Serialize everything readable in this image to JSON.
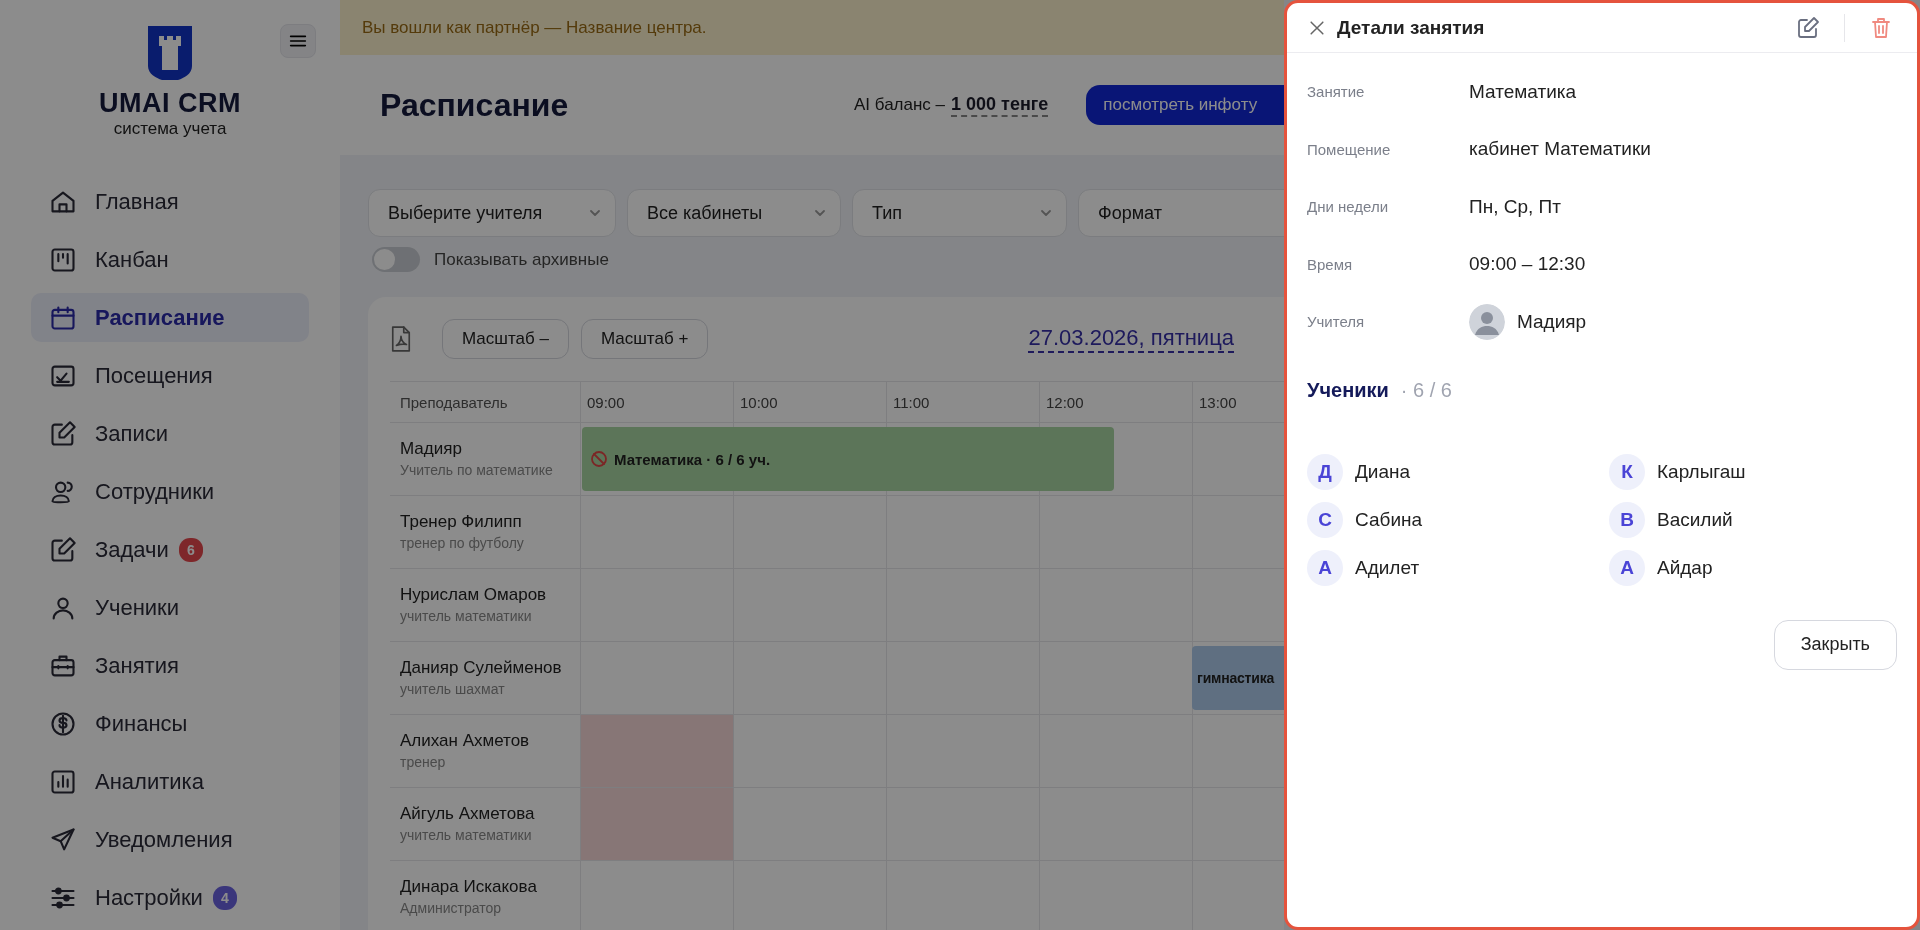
{
  "sidebar": {
    "logo": {
      "title": "UMAI CRM",
      "subtitle": "система учета"
    },
    "items": [
      {
        "label": "Главная",
        "selected": false
      },
      {
        "label": "Канбан",
        "selected": false
      },
      {
        "label": "Расписание",
        "selected": true
      },
      {
        "label": "Посещения",
        "selected": false
      },
      {
        "label": "Записи",
        "selected": false
      },
      {
        "label": "Сотрудники",
        "selected": false
      },
      {
        "label": "Задачи",
        "selected": false,
        "badge": {
          "text": "6",
          "kind": "alert"
        }
      },
      {
        "label": "Ученики",
        "selected": false
      },
      {
        "label": "Занятия",
        "selected": false
      },
      {
        "label": "Финансы",
        "selected": false
      },
      {
        "label": "Аналитика",
        "selected": false
      },
      {
        "label": "Уведомления",
        "selected": false
      },
      {
        "label": "Настройки",
        "selected": false,
        "badge": {
          "text": "4",
          "kind": "info"
        }
      }
    ]
  },
  "banner": "Вы вошли как партнёр — Название центра.",
  "header": {
    "title": "Расписание",
    "balance_label": "AI баланс –",
    "balance_value": "1 000 тенге",
    "button": "посмотреть инфоту"
  },
  "filters": [
    {
      "value": "Выберите учителя"
    },
    {
      "value": "Все кабинеты"
    },
    {
      "value": "Тип"
    },
    {
      "value": "Формат"
    }
  ],
  "archive_toggle": {
    "label": "Показывать архивные",
    "on": false
  },
  "toolbar": {
    "zoom_out": "Масштаб –",
    "zoom_in": "Масштаб +",
    "date": "27.03.2026, пятница"
  },
  "schedule": {
    "teacher_column": "Преподаватель",
    "hours": [
      "09:00",
      "10:00",
      "11:00",
      "12:00",
      "13:00"
    ],
    "rows": [
      {
        "name": "Мадияр",
        "role": "Учитель по математике",
        "cells": [
          {
            "kind": "free",
            "event": {
              "kind": "green",
              "title": "Математика · 6 / 6 уч.",
              "cancelled": true
            }
          },
          {
            "kind": "free"
          },
          {
            "kind": "free"
          },
          {
            "kind": "free"
          },
          {
            "kind": "free"
          }
        ]
      },
      {
        "name": "Тренер Филипп",
        "role": "тренер по футболу",
        "cells": [
          {
            "kind": "free"
          },
          {
            "kind": "free"
          },
          {
            "kind": "free"
          },
          {
            "kind": "free"
          },
          {
            "kind": "free"
          }
        ]
      },
      {
        "name": "Нурислам Омаров",
        "role": "учитель математики",
        "cells": [
          {
            "kind": "free"
          },
          {
            "kind": "free"
          },
          {
            "kind": "free"
          },
          {
            "kind": "free"
          },
          {
            "kind": "free"
          }
        ]
      },
      {
        "name": "Данияр Сулейменов",
        "role": "учитель шахмат",
        "cells": [
          {
            "kind": "free"
          },
          {
            "kind": "free"
          },
          {
            "kind": "free"
          },
          {
            "kind": "free"
          },
          {
            "kind": "free",
            "event": {
              "kind": "blue",
              "title": "гимнастика",
              "cancelled": false
            }
          }
        ]
      },
      {
        "name": "Алихан Ахметов",
        "role": "тренер",
        "cells": [
          {
            "kind": "blocked"
          },
          {
            "kind": "free"
          },
          {
            "kind": "free"
          },
          {
            "kind": "free"
          },
          {
            "kind": "free"
          }
        ]
      },
      {
        "name": "Айгуль Ахметова",
        "role": "учитель математики",
        "cells": [
          {
            "kind": "blocked"
          },
          {
            "kind": "free"
          },
          {
            "kind": "free"
          },
          {
            "kind": "free"
          },
          {
            "kind": "free"
          }
        ]
      },
      {
        "name": "Динара Искакова",
        "role": "Администратор",
        "cells": [
          {
            "kind": "free"
          },
          {
            "kind": "free"
          },
          {
            "kind": "free"
          },
          {
            "kind": "free"
          },
          {
            "kind": "free"
          }
        ]
      }
    ]
  },
  "details": {
    "title": "Детали занятия",
    "fields": [
      {
        "label": "Занятие",
        "value": "Математика"
      },
      {
        "label": "Помещение",
        "value": "кабинет Математики"
      },
      {
        "label": "Дни недели",
        "value": "Пн, Ср, Пт"
      },
      {
        "label": "Время",
        "value": "09:00 – 12:30"
      },
      {
        "label": "Учителя",
        "value": "Мадияр",
        "kind": "person"
      }
    ],
    "students_title": "Ученики",
    "students_count": "· 6 / 6",
    "students": [
      {
        "initial": "Д",
        "name": "Диана"
      },
      {
        "initial": "К",
        "name": "Карлыгаш"
      },
      {
        "initial": "С",
        "name": "Сабина"
      },
      {
        "initial": "В",
        "name": "Василий"
      },
      {
        "initial": "А",
        "name": "Адилет"
      },
      {
        "initial": "А",
        "name": "Айдар"
      }
    ],
    "close_button": "Закрыть"
  }
}
